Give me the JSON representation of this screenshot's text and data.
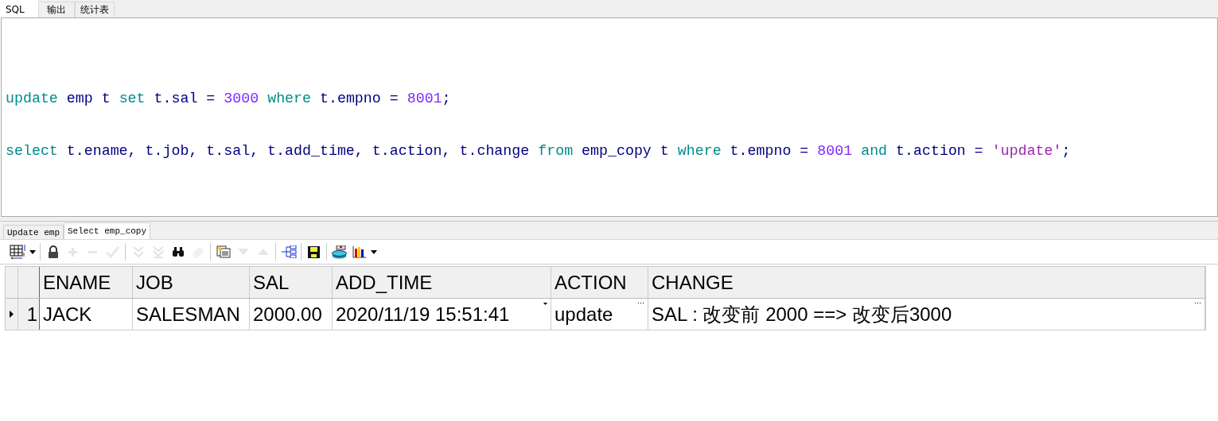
{
  "editor_tabs": [
    {
      "label": "SQL",
      "selected": true
    },
    {
      "label": "输出",
      "selected": false
    },
    {
      "label": "统计表",
      "selected": false
    }
  ],
  "sql_lines": [
    [
      {
        "kind": "keyword",
        "text": "update"
      },
      {
        "kind": "plain",
        "text": " emp t "
      },
      {
        "kind": "keyword",
        "text": "set"
      },
      {
        "kind": "plain",
        "text": " t.sal = "
      },
      {
        "kind": "number",
        "text": "3000"
      },
      {
        "kind": "keyword",
        "text": " where"
      },
      {
        "kind": "plain",
        "text": " t.empno = "
      },
      {
        "kind": "number",
        "text": "8001"
      },
      {
        "kind": "plain",
        "text": ";"
      }
    ],
    [
      {
        "kind": "keyword",
        "text": "select"
      },
      {
        "kind": "plain",
        "text": " t.ename, t.job, t.sal, t.add_time, t.action, t.change "
      },
      {
        "kind": "keyword",
        "text": "from"
      },
      {
        "kind": "plain",
        "text": " emp_copy t "
      },
      {
        "kind": "keyword",
        "text": "where"
      },
      {
        "kind": "plain",
        "text": " t.empno = "
      },
      {
        "kind": "number",
        "text": "8001"
      },
      {
        "kind": "keyword",
        "text": " and"
      },
      {
        "kind": "plain",
        "text": " t.action = "
      },
      {
        "kind": "string",
        "text": "'update'"
      },
      {
        "kind": "plain",
        "text": ";"
      }
    ]
  ],
  "result_tabs": [
    {
      "label": "Update emp",
      "selected": false
    },
    {
      "label": "Select emp_copy",
      "selected": true
    }
  ],
  "toolbar": [
    {
      "kind": "grid",
      "disabled": false
    },
    {
      "kind": "dropdown",
      "disabled": false
    },
    {
      "kind": "sep"
    },
    {
      "kind": "lock",
      "disabled": false
    },
    {
      "kind": "plus",
      "disabled": true
    },
    {
      "kind": "minus",
      "disabled": true
    },
    {
      "kind": "check",
      "disabled": true
    },
    {
      "kind": "sep"
    },
    {
      "kind": "down-double",
      "disabled": true
    },
    {
      "kind": "bottom",
      "disabled": true
    },
    {
      "kind": "binoculars",
      "disabled": false
    },
    {
      "kind": "eraser",
      "disabled": true
    },
    {
      "kind": "sep"
    },
    {
      "kind": "query",
      "disabled": false
    },
    {
      "kind": "down",
      "disabled": true
    },
    {
      "kind": "up",
      "disabled": true
    },
    {
      "kind": "sep"
    },
    {
      "kind": "tree",
      "disabled": false
    },
    {
      "kind": "sep"
    },
    {
      "kind": "save",
      "disabled": false
    },
    {
      "kind": "sep"
    },
    {
      "kind": "database",
      "disabled": false
    },
    {
      "kind": "chart",
      "disabled": false
    },
    {
      "kind": "dropdown",
      "disabled": false
    }
  ],
  "table": {
    "columns": [
      "ENAME",
      "JOB",
      "SAL",
      "ADD_TIME",
      "ACTION",
      "CHANGE"
    ],
    "rows": [
      {
        "number": "1",
        "selected": true,
        "cells": [
          "JACK",
          "SALESMAN",
          "2000.00",
          "2020/11/19 15:51:41",
          "update",
          "SAL : 改变前 2000 ==> 改变后3000"
        ]
      }
    ]
  }
}
